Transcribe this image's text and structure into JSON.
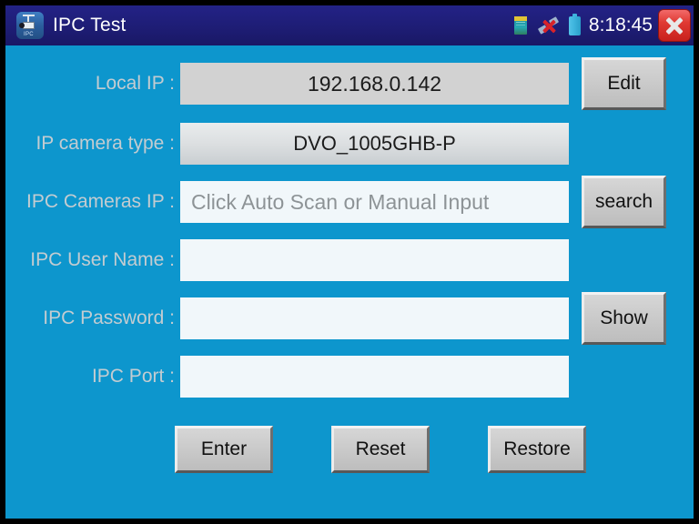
{
  "window": {
    "title": "IPC Test",
    "app_icon": "ipc-camera-icon",
    "background_color": "#0d96cd",
    "titlebar_color": "#1e1d75"
  },
  "statusbar": {
    "storage_icon": "sd-card-icon",
    "network_icon": "network-disconnected-icon",
    "battery_icon": "battery-icon",
    "clock": "8:18:45",
    "close_icon": "close-icon"
  },
  "form": {
    "rows": [
      {
        "label": "Local IP :",
        "name": "local-ip",
        "type": "readonly",
        "value": "192.168.0.142",
        "placeholder": "",
        "button": "Edit",
        "button_name": "edit-button"
      },
      {
        "label": "IP camera type :",
        "name": "ip-camera-type",
        "type": "combo",
        "value": "DVO_1005GHB-P",
        "placeholder": "",
        "button": "",
        "button_name": ""
      },
      {
        "label": "IPC Cameras IP :",
        "name": "ipc-cameras-ip",
        "type": "input",
        "value": "",
        "placeholder": "Click Auto Scan or Manual Input",
        "button": "search",
        "button_name": "search-button"
      },
      {
        "label": "IPC User Name :",
        "name": "ipc-user-name",
        "type": "input",
        "value": "",
        "placeholder": "",
        "button": "",
        "button_name": ""
      },
      {
        "label": "IPC Password :",
        "name": "ipc-password",
        "type": "input",
        "value": "",
        "placeholder": "",
        "button": "Show",
        "button_name": "show-password-button"
      },
      {
        "label": "IPC Port :",
        "name": "ipc-port",
        "type": "input",
        "value": "",
        "placeholder": "",
        "button": "",
        "button_name": ""
      }
    ]
  },
  "actions": {
    "enter": "Enter",
    "reset": "Reset",
    "restore": "Restore"
  }
}
